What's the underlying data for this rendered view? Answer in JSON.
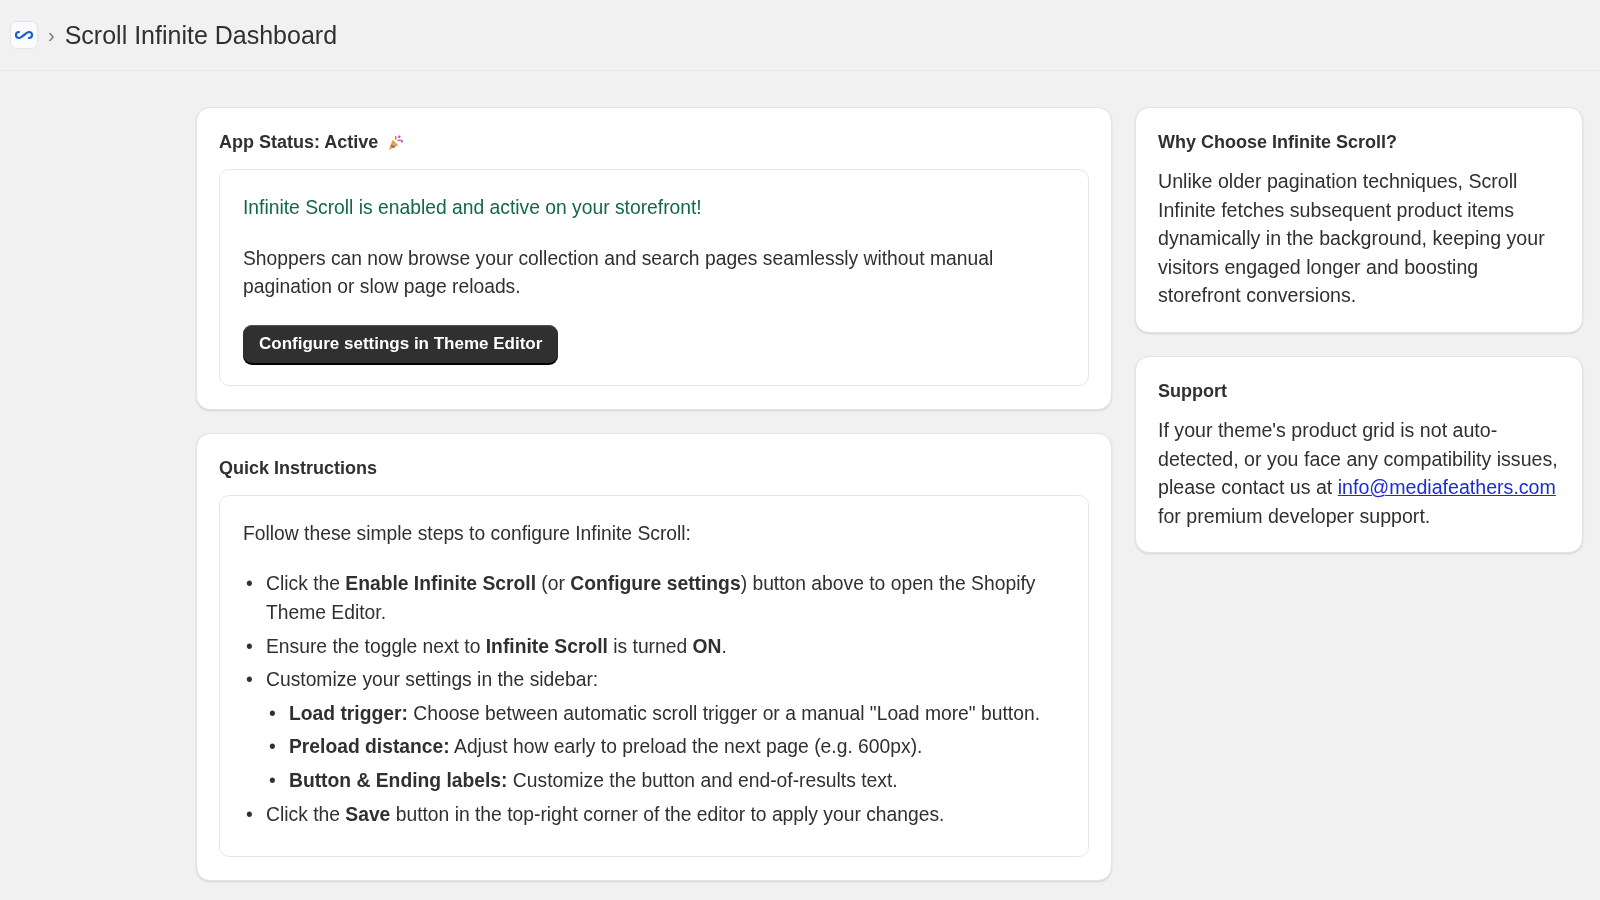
{
  "header": {
    "title": "Scroll Infinite Dashboard",
    "separator": "›"
  },
  "status_card": {
    "title": "App Status: Active",
    "status_message": "Infinite Scroll is enabled and active on your storefront!",
    "description": "Shoppers can now browse your collection and search pages seamlessly without manual pagination or slow page reloads.",
    "button": "Configure settings in Theme Editor"
  },
  "instructions_card": {
    "title": "Quick Instructions",
    "intro": "Follow these simple steps to configure Infinite Scroll:",
    "steps": [
      {
        "marker": "•",
        "text": "Click the **Enable Infinite Scroll** (or **Configure settings**) button above to open the Shopify Theme Editor."
      },
      {
        "marker": "•",
        "text": "Ensure the toggle next to **Infinite Scroll** is turned **ON**."
      },
      {
        "marker": "•",
        "text": "Customize your settings in the sidebar:",
        "children": [
          {
            "marker": "•",
            "text": "**Load trigger:** Choose between automatic scroll trigger or a manual \"Load more\" button."
          },
          {
            "marker": "•",
            "text": "**Preload distance:** Adjust how early to preload the next page (e.g. 600px)."
          },
          {
            "marker": "•",
            "text": "**Button & Ending labels:** Customize the button and end-of-results text."
          }
        ]
      },
      {
        "marker": "•",
        "text": "Click the **Save** button in the top-right corner of the editor to apply your changes."
      }
    ]
  },
  "why_card": {
    "title": "Why Choose Infinite Scroll?",
    "body": "Unlike older pagination techniques, Scroll Infinite fetches subsequent product items dynamically in the background, keeping your visitors engaged longer and boosting storefront conversions."
  },
  "support_card": {
    "title": "Support",
    "body_before": "If your theme's product grid is not auto-detected, or you face any compatibility issues, please contact us at",
    "email": "info@mediafeathers.com",
    "body_after": "for premium developer support."
  }
}
